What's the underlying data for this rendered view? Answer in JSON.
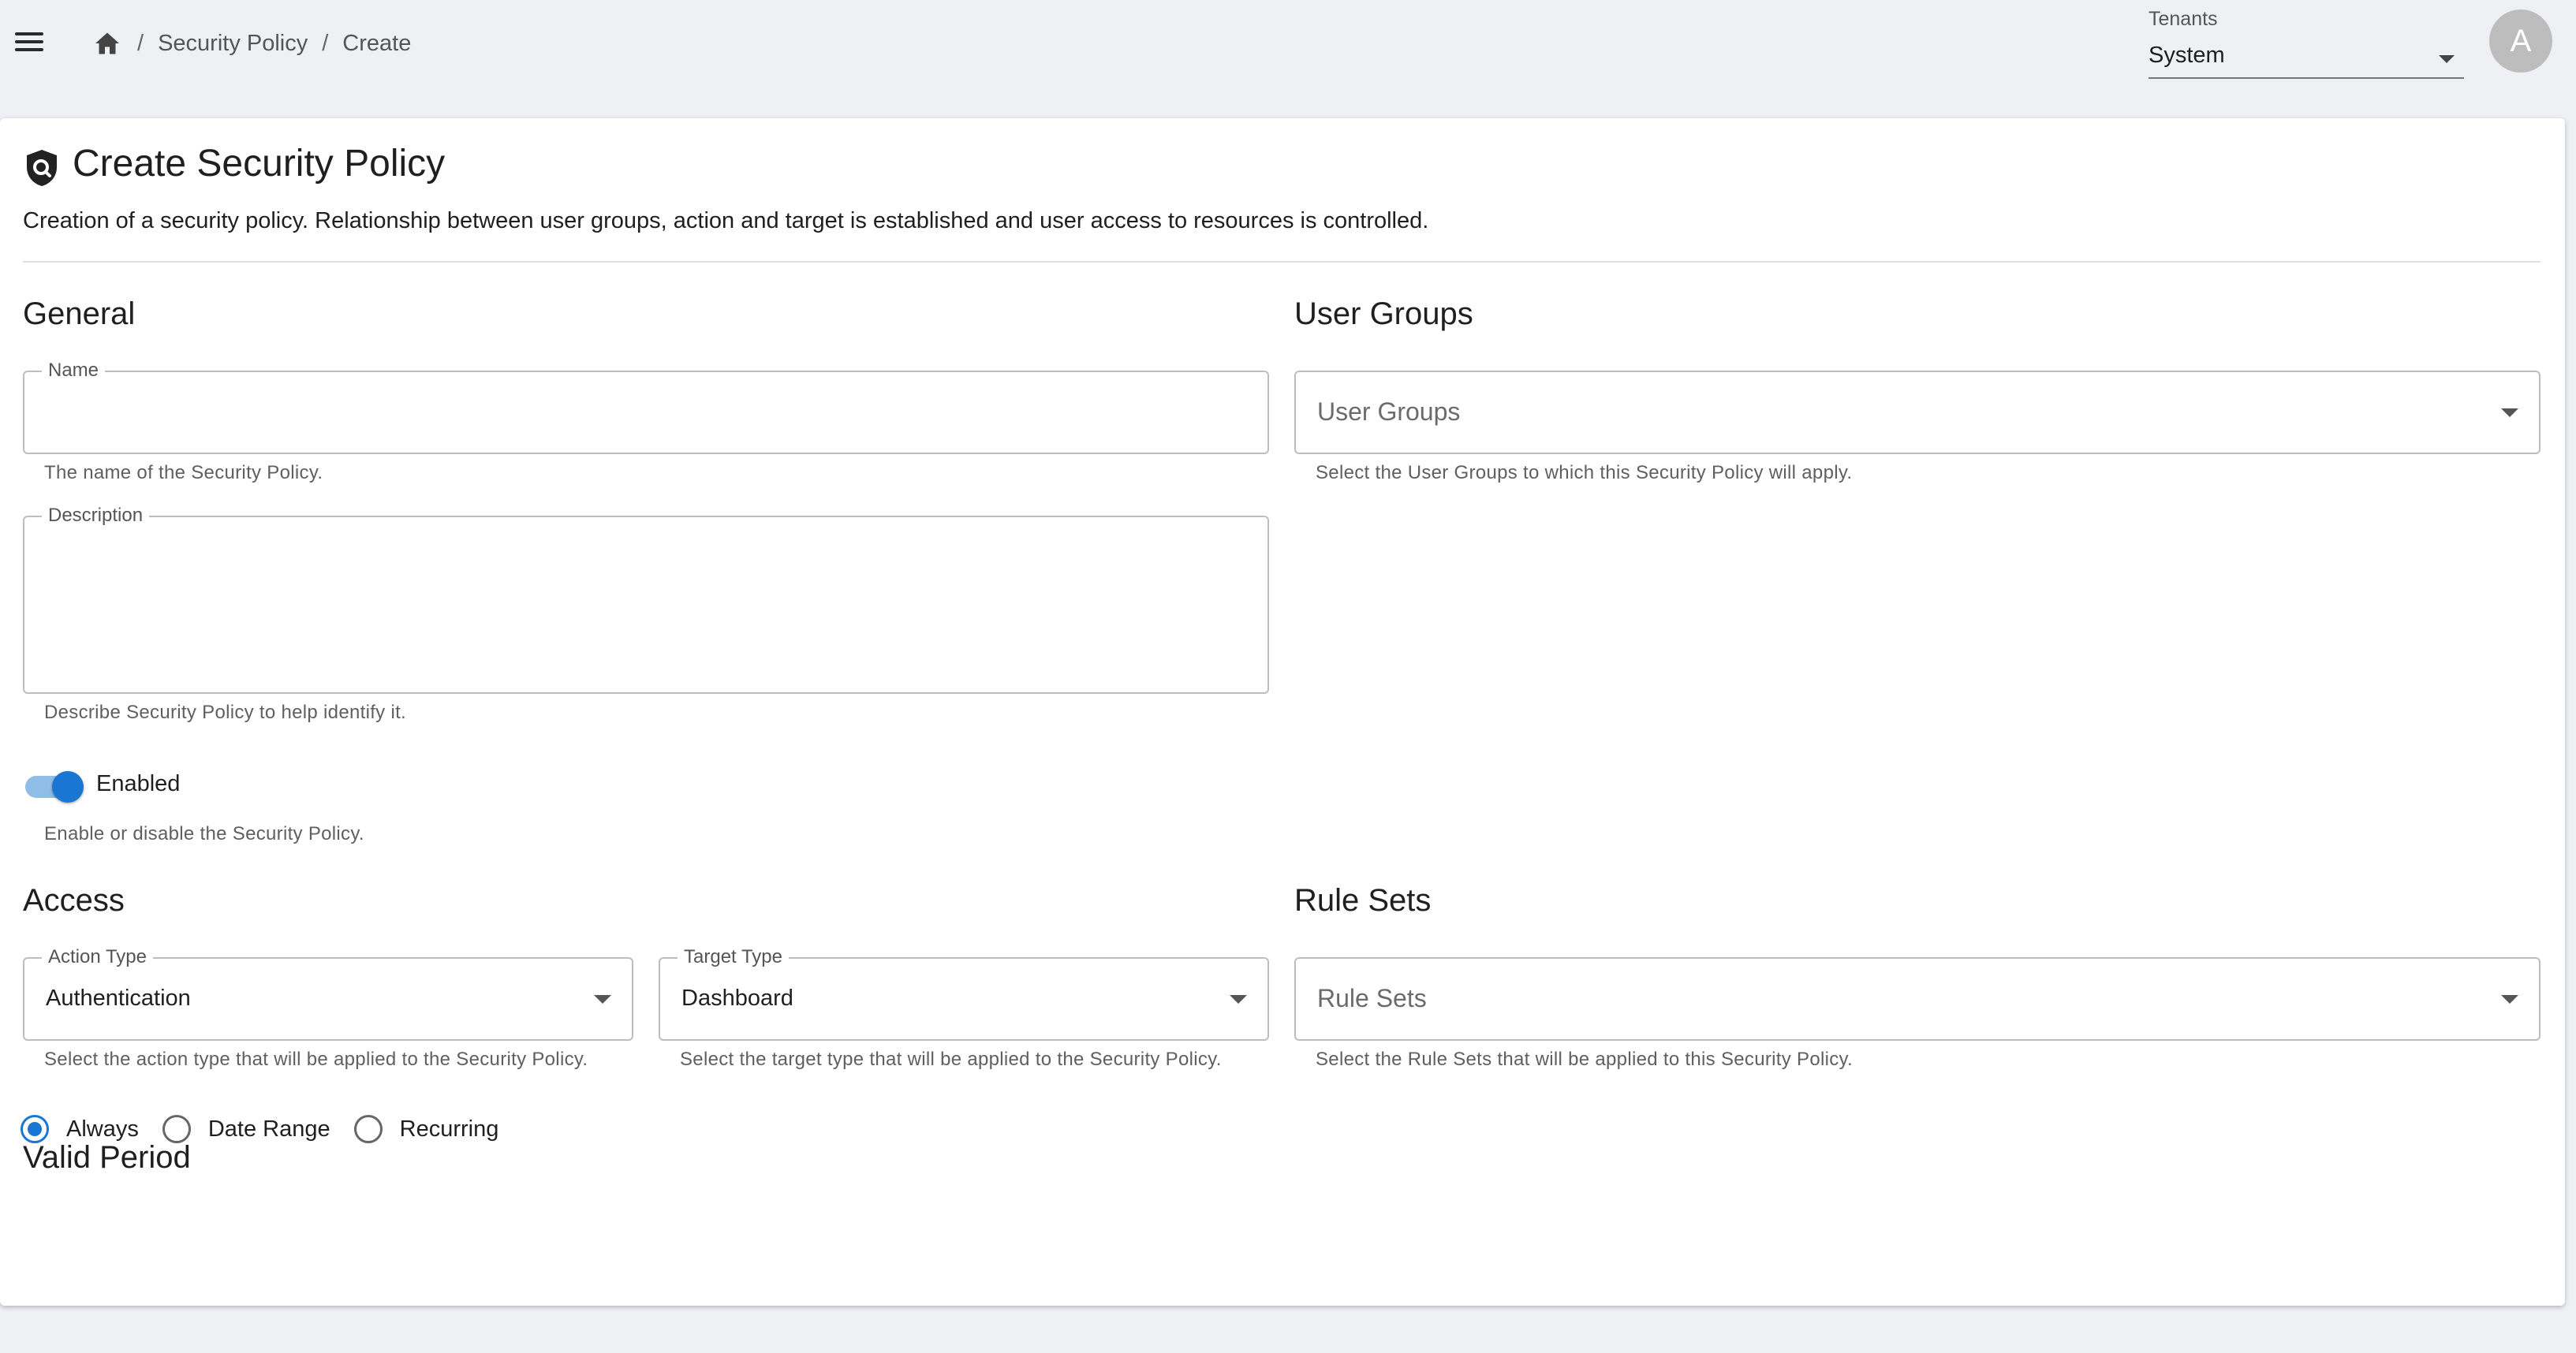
{
  "header": {
    "breadcrumb": {
      "home_icon": "home-icon",
      "items": [
        "Security Policy",
        "Create"
      ],
      "separator": "/"
    },
    "tenant": {
      "label": "Tenants",
      "value": "System"
    },
    "avatar_initial": "A"
  },
  "page": {
    "title": "Create Security Policy",
    "title_icon": "shield-search-icon",
    "description": "Creation of a security policy. Relationship between user groups, action and target is established and user access to resources is controlled."
  },
  "general": {
    "heading": "General",
    "name": {
      "label": "Name",
      "value": "",
      "helper": "The name of the Security Policy."
    },
    "description": {
      "label": "Description",
      "value": "",
      "helper": "Describe Security Policy to help identify it."
    },
    "enabled": {
      "label": "Enabled",
      "checked": true,
      "helper": "Enable or disable the Security Policy."
    }
  },
  "user_groups": {
    "heading": "User Groups",
    "placeholder": "User Groups",
    "helper": "Select the User Groups to which this Security Policy will apply."
  },
  "access": {
    "heading": "Access",
    "action_type": {
      "label": "Action Type",
      "value": "Authentication",
      "helper": "Select the action type that will be applied to the Security Policy."
    },
    "target_type": {
      "label": "Target Type",
      "value": "Dashboard",
      "helper": "Select the target type that will be applied to the Security Policy."
    }
  },
  "rule_sets": {
    "heading": "Rule Sets",
    "placeholder": "Rule Sets",
    "helper": "Select the Rule Sets that will be applied to this Security Policy."
  },
  "valid_period": {
    "heading": "Valid Period",
    "options": [
      "Always",
      "Date Range",
      "Recurring"
    ],
    "selected": "Always"
  },
  "colors": {
    "accent": "#1976d2",
    "background": "#eef0f4",
    "card": "#ffffff"
  }
}
